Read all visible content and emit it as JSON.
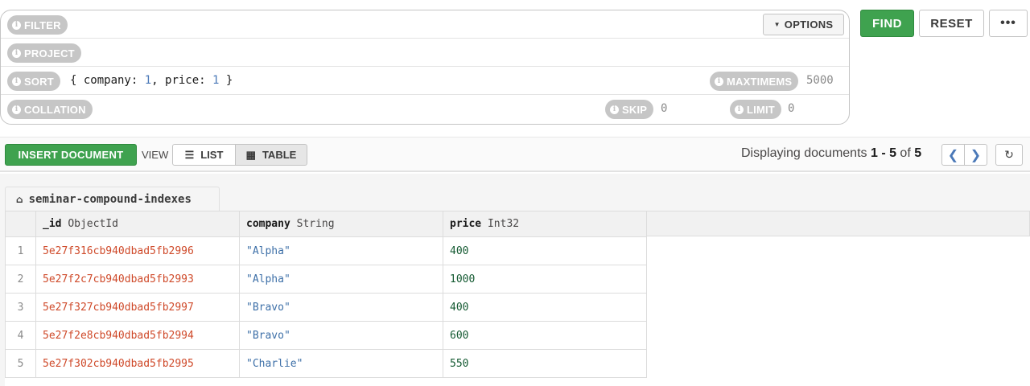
{
  "query": {
    "filter_label": "FILTER",
    "project_label": "PROJECT",
    "sort_label": "SORT",
    "sort_prefix": "{ company: ",
    "sort_v1": "1",
    "sort_mid": ", price: ",
    "sort_v2": "1",
    "sort_suffix": " }",
    "maxtimems_label": "MAXTIMEMS",
    "maxtimems_value": "5000",
    "collation_label": "COLLATION",
    "skip_label": "SKIP",
    "skip_value": "0",
    "limit_label": "LIMIT",
    "limit_value": "0",
    "options_label": "OPTIONS"
  },
  "actions": {
    "find": "FIND",
    "reset": "RESET",
    "more": "•••"
  },
  "toolbar": {
    "insert_label": "INSERT DOCUMENT",
    "view_label": "VIEW",
    "list_label": "LIST",
    "table_label": "TABLE",
    "display_prefix": "Displaying documents ",
    "display_range": "1 - 5",
    "display_of": " of ",
    "display_total": "5"
  },
  "collection": {
    "name": "seminar-compound-indexes"
  },
  "table": {
    "columns": [
      {
        "name": "_id",
        "type": "ObjectId"
      },
      {
        "name": "company",
        "type": "String"
      },
      {
        "name": "price",
        "type": "Int32"
      }
    ],
    "rows": [
      {
        "index": "1",
        "_id": "5e27f316cb940dbad5fb2996",
        "company": "\"Alpha\"",
        "price": "400"
      },
      {
        "index": "2",
        "_id": "5e27f2c7cb940dbad5fb2993",
        "company": "\"Alpha\"",
        "price": "1000"
      },
      {
        "index": "3",
        "_id": "5e27f327cb940dbad5fb2997",
        "company": "\"Bravo\"",
        "price": "400"
      },
      {
        "index": "4",
        "_id": "5e27f2e8cb940dbad5fb2994",
        "company": "\"Bravo\"",
        "price": "600"
      },
      {
        "index": "5",
        "_id": "5e27f302cb940dbad5fb2995",
        "company": "\"Charlie\"",
        "price": "550"
      }
    ]
  },
  "colors": {
    "accent_green": "#3fa24f",
    "objectid": "#cf4a2a",
    "string": "#3e70a8",
    "int": "#145a32",
    "pill_gray": "#c6c6c6"
  }
}
